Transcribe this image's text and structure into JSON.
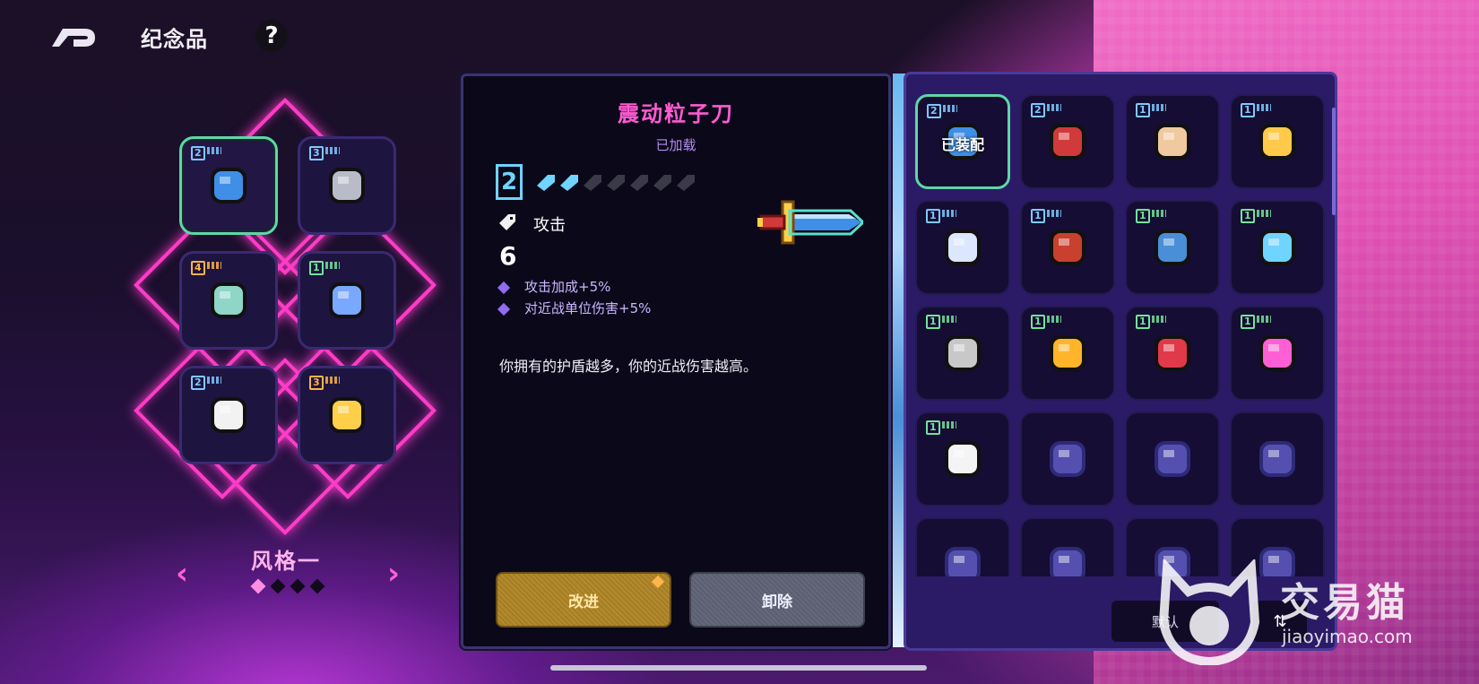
{
  "header": {
    "title": "纪念品",
    "help_label": "?"
  },
  "style_selector": {
    "name": "风格一",
    "prev": "‹",
    "next": "›",
    "pages": 4,
    "active_page": 0
  },
  "loadout_slots": [
    {
      "tier": "2",
      "tier_color": "blue",
      "icon": "particle-blade-icon",
      "selected": true
    },
    {
      "tier": "3",
      "tier_color": "blue",
      "icon": "viking-helmet-icon",
      "selected": false
    },
    {
      "tier": "4",
      "tier_color": "orange",
      "icon": "telephone-icon",
      "selected": false
    },
    {
      "tier": "1",
      "tier_color": "green",
      "icon": "shield-orb-icon",
      "selected": false
    },
    {
      "tier": "2",
      "tier_color": "blue",
      "icon": "chicken-head-icon",
      "selected": false
    },
    {
      "tier": "3",
      "tier_color": "orange",
      "icon": "triangle-ruler-icon",
      "selected": false
    }
  ],
  "detail": {
    "name": "震动粒子刀",
    "status": "已加载",
    "tier": "2",
    "upgrade_level": 2,
    "upgrade_max": 7,
    "stat_label": "攻击",
    "stat_value": "6",
    "bonuses": [
      "攻击加成+5%",
      "对近战单位伤害+5%"
    ],
    "description": "你拥有的护盾越多，你的近战伤害越高。",
    "upgrade_button": "改进",
    "remove_button": "卸除",
    "colors": {
      "title": "#ff5bd1",
      "status": "#b48cf0"
    }
  },
  "inventory": {
    "equipped_label": "已装配",
    "default_button": "默认",
    "items": [
      {
        "tier": "2",
        "tier_color": "blue",
        "icon": "particle-blade-icon",
        "equipped": true
      },
      {
        "tier": "2",
        "tier_color": "blue",
        "icon": "red-capsule-icon",
        "equipped": false
      },
      {
        "tier": "1",
        "tier_color": "blue",
        "icon": "scroll-map-icon",
        "equipped": false
      },
      {
        "tier": "1",
        "tier_color": "blue",
        "icon": "ticket-card-icon",
        "equipped": false
      },
      {
        "tier": "1",
        "tier_color": "blue",
        "icon": "speech-bubble-icon",
        "equipped": false
      },
      {
        "tier": "1",
        "tier_color": "blue",
        "icon": "hot-sauce-bottle-icon",
        "equipped": false
      },
      {
        "tier": "1",
        "tier_color": "green",
        "icon": "shark-head-icon",
        "equipped": false
      },
      {
        "tier": "1",
        "tier_color": "green",
        "icon": "sunglasses-icon",
        "equipped": false
      },
      {
        "tier": "1",
        "tier_color": "green",
        "icon": "flask-icon",
        "equipped": false
      },
      {
        "tier": "1",
        "tier_color": "green",
        "icon": "gold-badge-icon",
        "equipped": false
      },
      {
        "tier": "1",
        "tier_color": "green",
        "icon": "phone-device-icon",
        "equipped": false
      },
      {
        "tier": "1",
        "tier_color": "green",
        "icon": "eye-monster-icon",
        "equipped": false
      },
      {
        "tier": "1",
        "tier_color": "green",
        "icon": "milk-bottle-icon",
        "equipped": false
      },
      {
        "tier": "",
        "tier_color": "",
        "icon": "locked-gun-icon",
        "equipped": false
      },
      {
        "tier": "",
        "tier_color": "",
        "icon": "locked-helmet-icon",
        "equipped": false
      },
      {
        "tier": "",
        "tier_color": "",
        "icon": "locked-card-icon",
        "equipped": false
      },
      {
        "tier": "",
        "tier_color": "",
        "icon": "locked-armor-icon",
        "equipped": false
      },
      {
        "tier": "",
        "tier_color": "",
        "icon": "locked-fang-icon",
        "equipped": false
      },
      {
        "tier": "",
        "tier_color": "",
        "icon": "locked-bottle-icon",
        "equipped": false
      },
      {
        "tier": "",
        "tier_color": "",
        "icon": "locked-lamp-icon",
        "equipped": false
      }
    ]
  },
  "watermark": {
    "brand": "交易猫",
    "url": "jiaoyimao.com"
  }
}
